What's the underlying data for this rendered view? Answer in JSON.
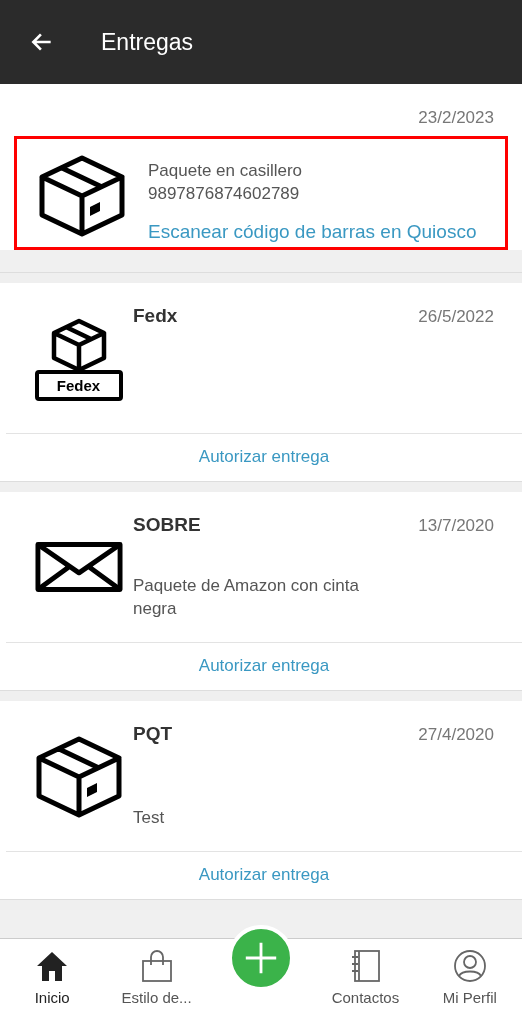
{
  "app_bar": {
    "title": "Entregas"
  },
  "deliveries": [
    {
      "kind": "locker",
      "date": "23/2/2023",
      "highlighted": true,
      "description": "Paquete en casillero",
      "code": "9897876874602789",
      "action": "Escanear código de barras en Quiosco"
    },
    {
      "kind": "labeled-box",
      "icon_label": "Fedex",
      "title": "Fedx",
      "date": "26/5/2022",
      "action": "Autorizar entrega"
    },
    {
      "kind": "envelope",
      "title": "SOBRE",
      "date": "13/7/2020",
      "description": "Paquete de Amazon con cinta negra",
      "action": "Autorizar entrega"
    },
    {
      "kind": "box",
      "title": "PQT",
      "date": "27/4/2020",
      "description": "Test",
      "action": "Autorizar entrega"
    }
  ],
  "bottom_nav": [
    {
      "kind": "home",
      "label": "Inicio",
      "selected": true
    },
    {
      "kind": "bag",
      "label": "Estilo de...",
      "selected": false
    },
    {
      "kind": "add",
      "selected": false
    },
    {
      "kind": "book",
      "label": "Contactos",
      "selected": false
    },
    {
      "kind": "profile",
      "label": "Mi Perfil",
      "selected": false
    }
  ]
}
